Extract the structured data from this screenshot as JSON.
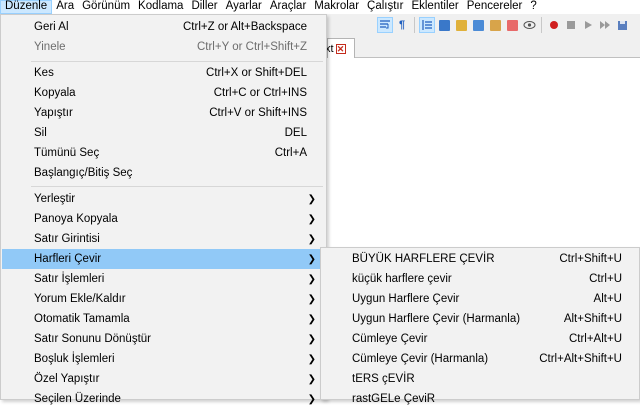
{
  "menubar": [
    "Düzenle",
    "Ara",
    "Görünüm",
    "Kodlama",
    "Diller",
    "Ayarlar",
    "Araçlar",
    "Makrolar",
    "Çalıştır",
    "Eklentiler",
    "Pencereler",
    "?"
  ],
  "tab": {
    "label": "xt",
    "close": "✕"
  },
  "colors": {
    "highlight": "#91c9f7",
    "menu_bg": "#f2f2f2",
    "active_menu": "#cce8ff"
  },
  "edit_menu": {
    "undo": {
      "label": "Geri Al",
      "shortcut": "Ctrl+Z or Alt+Backspace"
    },
    "redo": {
      "label": "Yinele",
      "shortcut": "Ctrl+Y or Ctrl+Shift+Z"
    },
    "cut": {
      "label": "Kes",
      "shortcut": "Ctrl+X or Shift+DEL"
    },
    "copy": {
      "label": "Kopyala",
      "shortcut": "Ctrl+C or Ctrl+INS"
    },
    "paste": {
      "label": "Yapıştır",
      "shortcut": "Ctrl+V or Shift+INS"
    },
    "delete": {
      "label": "Sil",
      "shortcut": "DEL"
    },
    "select_all": {
      "label": "Tümünü Seç",
      "shortcut": "Ctrl+A"
    },
    "begin_end_select": {
      "label": "Başlangıç/Bitiş Seç"
    },
    "insert": {
      "label": "Yerleştir"
    },
    "copy_to_clipboard": {
      "label": "Panoya Kopyala"
    },
    "indent": {
      "label": "Satır Girintisi"
    },
    "convert_case": {
      "label": "Harfleri Çevir"
    },
    "line_ops": {
      "label": "Satır İşlemleri"
    },
    "comment": {
      "label": "Yorum Ekle/Kaldır"
    },
    "auto_complete": {
      "label": "Otomatik Tamamla"
    },
    "eol_conversion": {
      "label": "Satır Sonunu Dönüştür"
    },
    "blank_ops": {
      "label": "Boşluk İşlemleri"
    },
    "paste_special": {
      "label": "Özel Yapıştır"
    },
    "on_selection": {
      "label": "Seçilen Üzerinde"
    }
  },
  "case_submenu": [
    {
      "label": "BÜYÜK HARFLERE ÇEVİR",
      "shortcut": "Ctrl+Shift+U"
    },
    {
      "label": "küçük harflere çevir",
      "shortcut": "Ctrl+U"
    },
    {
      "label": "Uygun Harflere Çevir",
      "shortcut": "Alt+U"
    },
    {
      "label": "Uygun Harflere Çevir (Harmanla)",
      "shortcut": "Alt+Shift+U"
    },
    {
      "label": "Cümleye Çevir",
      "shortcut": "Ctrl+Alt+U"
    },
    {
      "label": "Cümleye Çevir (Harmanla)",
      "shortcut": "Ctrl+Alt+Shift+U"
    },
    {
      "label": "tERS çEVİR",
      "shortcut": ""
    },
    {
      "label": "rastGELe ÇeviR",
      "shortcut": ""
    }
  ]
}
